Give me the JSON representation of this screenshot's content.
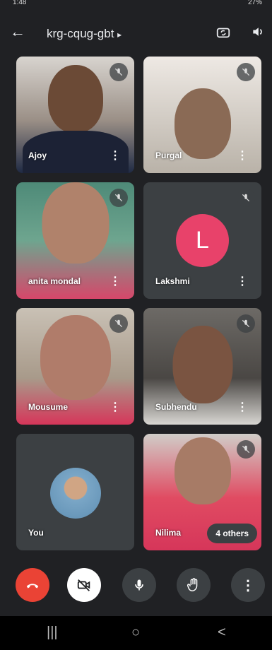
{
  "status": {
    "time": "1:48",
    "battery": "27%"
  },
  "header": {
    "meeting_code": "krg-cqug-gbt",
    "caret": "▸",
    "back_icon": "arrow-left-icon",
    "camera_switch_icon": "camera-flip-icon",
    "audio_icon": "speaker-icon"
  },
  "tiles": [
    {
      "name": "Ajoy",
      "muted": true
    },
    {
      "name": "Purgal",
      "muted": true
    },
    {
      "name": "anita mondal",
      "muted": true
    },
    {
      "name": "Lakshmi",
      "muted": true,
      "initial": "L",
      "avatar_color": "#e8426a"
    },
    {
      "name": "Mousume",
      "muted": true
    },
    {
      "name": "Subhendu",
      "muted": true
    },
    {
      "name": "You"
    },
    {
      "name": "Nilima",
      "muted": true,
      "others": "4 others"
    }
  ],
  "controls": {
    "end_call_color": "#ea4335"
  },
  "nav": {
    "recent": "|||",
    "home": "○",
    "back": "<"
  }
}
